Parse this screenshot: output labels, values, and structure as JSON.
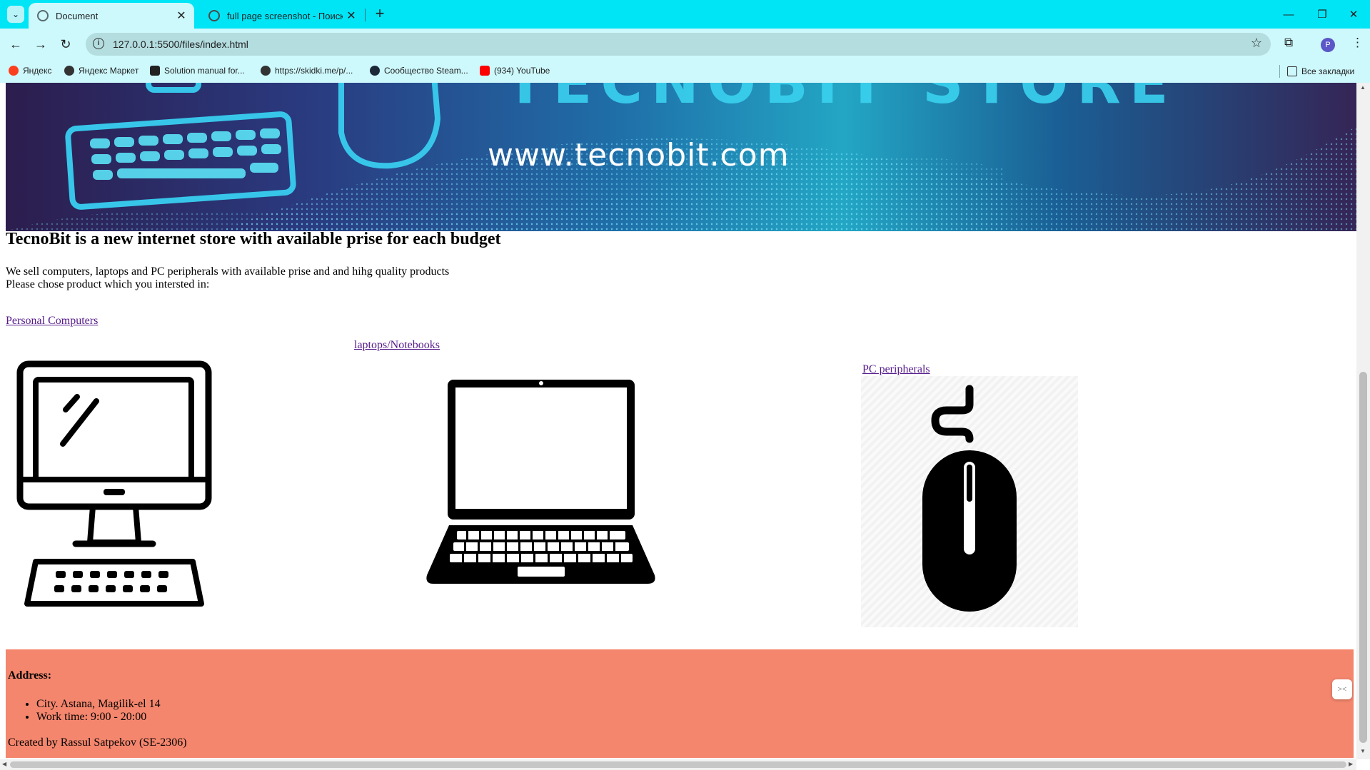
{
  "browser": {
    "tabs": [
      {
        "title": "Document",
        "active": true
      },
      {
        "title": "full page screenshot - Поиск в",
        "active": false
      }
    ],
    "new_tab_label": "+",
    "address": "127.0.0.1:5500/files/index.html",
    "profile_initial": "P",
    "bookmarks": [
      {
        "label": "Яндекс",
        "icon": "yandex-icon",
        "color": "#fc3f1d"
      },
      {
        "label": "Яндекс Маркет",
        "icon": "globe-icon",
        "color": "#333333"
      },
      {
        "label": "Solution manual for...",
        "icon": "site-icon",
        "color": "#222222"
      },
      {
        "label": "https://skidki.me/p/...",
        "icon": "globe-icon",
        "color": "#333333"
      },
      {
        "label": "Сообщество Steam...",
        "icon": "steam-icon",
        "color": "#1b2838"
      },
      {
        "label": "(934) YouTube",
        "icon": "youtube-icon",
        "color": "#ff0000"
      }
    ],
    "all_bookmarks_label": "Все закладки",
    "colors": {
      "tabstrip": "#00e5f6",
      "toolbar": "#cdf8fc",
      "omnibox": "#b4dde0"
    }
  },
  "page": {
    "banner": {
      "url_text": "www.tecnobit.com",
      "title_text": "TECNOBIT STORE"
    },
    "heading": "TecnoBit is a new internet store with available prise for each budget",
    "intro_line1": "We sell computers, laptops and PC peripherals with available prise and and hihg quality products",
    "intro_line2": "Please chose product which you intersted in:",
    "links": {
      "personal_computers": "Personal Computers",
      "laptops": "laptops/Notebooks",
      "peripherals": "PC peripherals"
    },
    "footer": {
      "address_label": "Address:",
      "items": [
        "City. Astana, Magilik-el 14",
        "Work time: 9:00 - 20:00"
      ],
      "credit": "Created by Rassul Satpekov (SE-2306)",
      "color": "#f4866d"
    },
    "link_color": "#551a8b"
  }
}
